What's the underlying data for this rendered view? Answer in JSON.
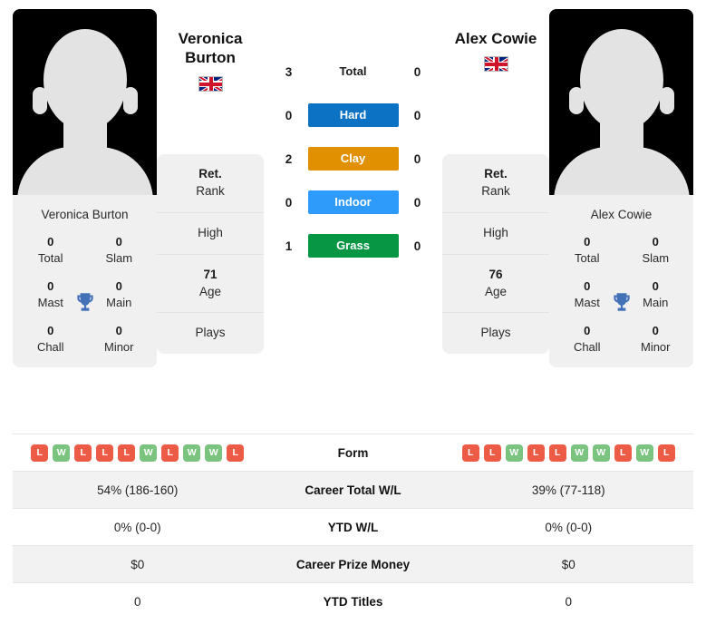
{
  "players": {
    "left": {
      "name_line1": "Veronica",
      "name_line2": "Burton",
      "full_name": "Veronica Burton",
      "country_flag": "uk-flag-icon",
      "avatar": "player-photo-placeholder",
      "titles": [
        {
          "num": "0",
          "label": "Total"
        },
        {
          "num": "0",
          "label": "Slam"
        },
        {
          "num": "0",
          "label": "Mast"
        },
        {
          "num": "0",
          "label": "Main"
        },
        {
          "num": "0",
          "label": "Chall"
        },
        {
          "num": "0",
          "label": "Minor"
        }
      ],
      "info": [
        {
          "num": "Ret.",
          "label": "Rank"
        },
        {
          "num": "",
          "label": "High"
        },
        {
          "num": "71",
          "label": "Age"
        },
        {
          "num": "",
          "label": "Plays"
        }
      ],
      "form": [
        "L",
        "W",
        "L",
        "L",
        "L",
        "W",
        "L",
        "W",
        "W",
        "L"
      ],
      "career_total_wl": "54% (186-160)",
      "ytd_wl": "0% (0-0)",
      "career_prize_money": "$0",
      "ytd_titles": "0"
    },
    "right": {
      "name_line1": "Alex Cowie",
      "name_line2": "",
      "full_name": "Alex Cowie",
      "country_flag": "uk-flag-icon",
      "avatar": "player-photo-placeholder",
      "titles": [
        {
          "num": "0",
          "label": "Total"
        },
        {
          "num": "0",
          "label": "Slam"
        },
        {
          "num": "0",
          "label": "Mast"
        },
        {
          "num": "0",
          "label": "Main"
        },
        {
          "num": "0",
          "label": "Chall"
        },
        {
          "num": "0",
          "label": "Minor"
        }
      ],
      "info": [
        {
          "num": "Ret.",
          "label": "Rank"
        },
        {
          "num": "",
          "label": "High"
        },
        {
          "num": "76",
          "label": "Age"
        },
        {
          "num": "",
          "label": "Plays"
        }
      ],
      "form": [
        "L",
        "L",
        "W",
        "L",
        "L",
        "W",
        "W",
        "L",
        "W",
        "L"
      ],
      "career_total_wl": "39% (77-118)",
      "ytd_wl": "0% (0-0)",
      "career_prize_money": "$0",
      "ytd_titles": "0"
    }
  },
  "h2h": [
    {
      "label": "Total",
      "left": "3",
      "right": "0",
      "color": "",
      "plain": true
    },
    {
      "label": "Hard",
      "left": "0",
      "right": "0",
      "color": "#0b72c4",
      "plain": false
    },
    {
      "label": "Clay",
      "left": "2",
      "right": "0",
      "color": "#e09000",
      "plain": false
    },
    {
      "label": "Indoor",
      "left": "0",
      "right": "0",
      "color": "#2e9bfb",
      "plain": false
    },
    {
      "label": "Grass",
      "left": "1",
      "right": "0",
      "color": "#069644",
      "plain": false
    }
  ],
  "stats_rows": [
    {
      "label": "Form",
      "type": "form"
    },
    {
      "label": "Career Total W/L",
      "type": "text",
      "key": "career_total_wl"
    },
    {
      "label": "YTD W/L",
      "type": "text",
      "key": "ytd_wl"
    },
    {
      "label": "Career Prize Money",
      "type": "text",
      "key": "career_prize_money"
    },
    {
      "label": "YTD Titles",
      "type": "text",
      "key": "ytd_titles"
    }
  ],
  "icons": {
    "trophy": "trophy-icon",
    "trophy_color": "#4472b8"
  }
}
